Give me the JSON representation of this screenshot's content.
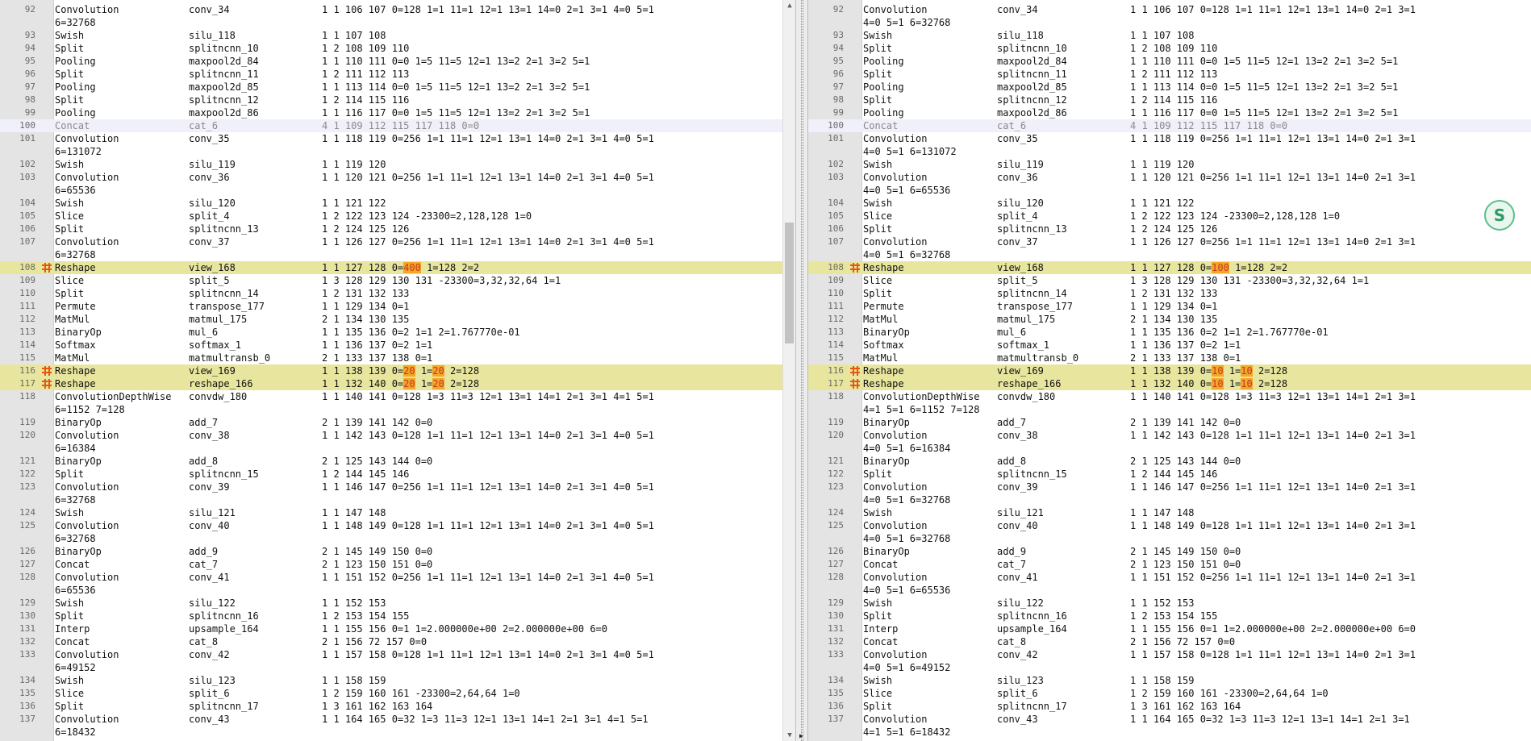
{
  "left": {
    "lines": [
      {
        "n": "92",
        "c": [
          "Convolution",
          "conv_34",
          "1 1 106 107 0=128 1=1 11=1 12=1 13=1 14=0 2=1 3=1 4=0 5=1"
        ]
      },
      {
        "n": "",
        "c": [
          "6=32768",
          "",
          ""
        ],
        "cont": true
      },
      {
        "n": "93",
        "c": [
          "Swish",
          "silu_118",
          "1 1 107 108"
        ]
      },
      {
        "n": "94",
        "c": [
          "Split",
          "splitncnn_10",
          "1 2 108 109 110"
        ]
      },
      {
        "n": "95",
        "c": [
          "Pooling",
          "maxpool2d_84",
          "1 1 110 111 0=0 1=5 11=5 12=1 13=2 2=1 3=2 5=1"
        ]
      },
      {
        "n": "96",
        "c": [
          "Split",
          "splitncnn_11",
          "1 2 111 112 113"
        ]
      },
      {
        "n": "97",
        "c": [
          "Pooling",
          "maxpool2d_85",
          "1 1 113 114 0=0 1=5 11=5 12=1 13=2 2=1 3=2 5=1"
        ]
      },
      {
        "n": "98",
        "c": [
          "Split",
          "splitncnn_12",
          "1 2 114 115 116"
        ]
      },
      {
        "n": "99",
        "c": [
          "Pooling",
          "maxpool2d_86",
          "1 1 116 117 0=0 1=5 11=5 12=1 13=2 2=1 3=2 5=1"
        ]
      },
      {
        "n": "100",
        "c": [
          "Concat",
          "cat_6",
          "4 1 109 112 115 117 118 0=0"
        ],
        "cur": true
      },
      {
        "n": "101",
        "c": [
          "Convolution",
          "conv_35",
          "1 1 118 119 0=256 1=1 11=1 12=1 13=1 14=0 2=1 3=1 4=0 5=1"
        ]
      },
      {
        "n": "",
        "c": [
          "6=131072",
          "",
          ""
        ],
        "cont": true
      },
      {
        "n": "102",
        "c": [
          "Swish",
          "silu_119",
          "1 1 119 120"
        ]
      },
      {
        "n": "103",
        "c": [
          "Convolution",
          "conv_36",
          "1 1 120 121 0=256 1=1 11=1 12=1 13=1 14=0 2=1 3=1 4=0 5=1"
        ]
      },
      {
        "n": "",
        "c": [
          "6=65536",
          "",
          ""
        ],
        "cont": true
      },
      {
        "n": "104",
        "c": [
          "Swish",
          "silu_120",
          "1 1 121 122"
        ]
      },
      {
        "n": "105",
        "c": [
          "Slice",
          "split_4",
          "1 2 122 123 124 -23300=2,128,128 1=0"
        ]
      },
      {
        "n": "106",
        "c": [
          "Split",
          "splitncnn_13",
          "1 2 124 125 126"
        ]
      },
      {
        "n": "107",
        "c": [
          "Convolution",
          "conv_37",
          "1 1 126 127 0=256 1=1 11=1 12=1 13=1 14=0 2=1 3=1 4=0 5=1"
        ]
      },
      {
        "n": "",
        "c": [
          "6=32768",
          "",
          ""
        ],
        "cont": true
      },
      {
        "n": "108",
        "c": [
          "Reshape",
          "view_168",
          "1 1 127 128 0="
        ],
        "diff": [
          "400"
        ],
        "tail": " 1=128 2=2",
        "hl": true
      },
      {
        "n": "109",
        "c": [
          "Slice",
          "split_5",
          "1 3 128 129 130 131 -23300=3,32,32,64 1=1"
        ]
      },
      {
        "n": "110",
        "c": [
          "Split",
          "splitncnn_14",
          "1 2 131 132 133"
        ]
      },
      {
        "n": "111",
        "c": [
          "Permute",
          "transpose_177",
          "1 1 129 134 0=1"
        ]
      },
      {
        "n": "112",
        "c": [
          "MatMul",
          "matmul_175",
          "2 1 134 130 135"
        ]
      },
      {
        "n": "113",
        "c": [
          "BinaryOp",
          "mul_6",
          "1 1 135 136 0=2 1=1 2=1.767770e-01"
        ]
      },
      {
        "n": "114",
        "c": [
          "Softmax",
          "softmax_1",
          "1 1 136 137 0=2 1=1"
        ]
      },
      {
        "n": "115",
        "c": [
          "MatMul",
          "matmultransb_0",
          "2 1 133 137 138 0=1"
        ]
      },
      {
        "n": "116",
        "c": [
          "Reshape",
          "view_169",
          "1 1 138 139 0="
        ],
        "diff": [
          "20",
          " 1=",
          "20"
        ],
        "tail": " 2=128",
        "hl": true
      },
      {
        "n": "117",
        "c": [
          "Reshape",
          "reshape_166",
          "1 1 132 140 0="
        ],
        "diff": [
          "20",
          " 1=",
          "20"
        ],
        "tail": " 2=128",
        "hl": true
      },
      {
        "n": "118",
        "c": [
          "ConvolutionDepthWise",
          "convdw_180",
          "1 1 140 141 0=128 1=3 11=3 12=1 13=1 14=1 2=1 3=1 4=1 5=1"
        ]
      },
      {
        "n": "",
        "c": [
          "6=1152 7=128",
          "",
          ""
        ],
        "cont": true
      },
      {
        "n": "119",
        "c": [
          "BinaryOp",
          "add_7",
          "2 1 139 141 142 0=0"
        ]
      },
      {
        "n": "120",
        "c": [
          "Convolution",
          "conv_38",
          "1 1 142 143 0=128 1=1 11=1 12=1 13=1 14=0 2=1 3=1 4=0 5=1"
        ]
      },
      {
        "n": "",
        "c": [
          "6=16384",
          "",
          ""
        ],
        "cont": true
      },
      {
        "n": "121",
        "c": [
          "BinaryOp",
          "add_8",
          "2 1 125 143 144 0=0"
        ]
      },
      {
        "n": "122",
        "c": [
          "Split",
          "splitncnn_15",
          "1 2 144 145 146"
        ]
      },
      {
        "n": "123",
        "c": [
          "Convolution",
          "conv_39",
          "1 1 146 147 0=256 1=1 11=1 12=1 13=1 14=0 2=1 3=1 4=0 5=1"
        ]
      },
      {
        "n": "",
        "c": [
          "6=32768",
          "",
          ""
        ],
        "cont": true
      },
      {
        "n": "124",
        "c": [
          "Swish",
          "silu_121",
          "1 1 147 148"
        ]
      },
      {
        "n": "125",
        "c": [
          "Convolution",
          "conv_40",
          "1 1 148 149 0=128 1=1 11=1 12=1 13=1 14=0 2=1 3=1 4=0 5=1"
        ]
      },
      {
        "n": "",
        "c": [
          "6=32768",
          "",
          ""
        ],
        "cont": true
      },
      {
        "n": "126",
        "c": [
          "BinaryOp",
          "add_9",
          "2 1 145 149 150 0=0"
        ]
      },
      {
        "n": "127",
        "c": [
          "Concat",
          "cat_7",
          "2 1 123 150 151 0=0"
        ]
      },
      {
        "n": "128",
        "c": [
          "Convolution",
          "conv_41",
          "1 1 151 152 0=256 1=1 11=1 12=1 13=1 14=0 2=1 3=1 4=0 5=1"
        ]
      },
      {
        "n": "",
        "c": [
          "6=65536",
          "",
          ""
        ],
        "cont": true
      },
      {
        "n": "129",
        "c": [
          "Swish",
          "silu_122",
          "1 1 152 153"
        ]
      },
      {
        "n": "130",
        "c": [
          "Split",
          "splitncnn_16",
          "1 2 153 154 155"
        ]
      },
      {
        "n": "131",
        "c": [
          "Interp",
          "upsample_164",
          "1 1 155 156 0=1 1=2.000000e+00 2=2.000000e+00 6=0"
        ]
      },
      {
        "n": "132",
        "c": [
          "Concat",
          "cat_8",
          "2 1 156 72 157 0=0"
        ]
      },
      {
        "n": "133",
        "c": [
          "Convolution",
          "conv_42",
          "1 1 157 158 0=128 1=1 11=1 12=1 13=1 14=0 2=1 3=1 4=0 5=1"
        ]
      },
      {
        "n": "",
        "c": [
          "6=49152",
          "",
          ""
        ],
        "cont": true
      },
      {
        "n": "134",
        "c": [
          "Swish",
          "silu_123",
          "1 1 158 159"
        ]
      },
      {
        "n": "135",
        "c": [
          "Slice",
          "split_6",
          "1 2 159 160 161 -23300=2,64,64 1=0"
        ]
      },
      {
        "n": "136",
        "c": [
          "Split",
          "splitncnn_17",
          "1 3 161 162 163 164"
        ]
      },
      {
        "n": "137",
        "c": [
          "Convolution",
          "conv_43",
          "1 1 164 165 0=32 1=3 11=3 12=1 13=1 14=1 2=1 3=1 4=1 5=1"
        ]
      },
      {
        "n": "",
        "c": [
          "6=18432",
          "",
          ""
        ],
        "cont": true
      }
    ]
  },
  "right": {
    "lines": [
      {
        "n": "92",
        "c": [
          "Convolution",
          "conv_34",
          "1 1 106 107 0=128 1=1 11=1 12=1 13=1 14=0 2=1 3=1"
        ]
      },
      {
        "n": "",
        "c": [
          "4=0 5=1 6=32768",
          "",
          ""
        ],
        "cont": true
      },
      {
        "n": "93",
        "c": [
          "Swish",
          "silu_118",
          "1 1 107 108"
        ]
      },
      {
        "n": "94",
        "c": [
          "Split",
          "splitncnn_10",
          "1 2 108 109 110"
        ]
      },
      {
        "n": "95",
        "c": [
          "Pooling",
          "maxpool2d_84",
          "1 1 110 111 0=0 1=5 11=5 12=1 13=2 2=1 3=2 5=1"
        ]
      },
      {
        "n": "96",
        "c": [
          "Split",
          "splitncnn_11",
          "1 2 111 112 113"
        ]
      },
      {
        "n": "97",
        "c": [
          "Pooling",
          "maxpool2d_85",
          "1 1 113 114 0=0 1=5 11=5 12=1 13=2 2=1 3=2 5=1"
        ]
      },
      {
        "n": "98",
        "c": [
          "Split",
          "splitncnn_12",
          "1 2 114 115 116"
        ]
      },
      {
        "n": "99",
        "c": [
          "Pooling",
          "maxpool2d_86",
          "1 1 116 117 0=0 1=5 11=5 12=1 13=2 2=1 3=2 5=1"
        ]
      },
      {
        "n": "100",
        "c": [
          "Concat",
          "cat_6",
          "4 1 109 112 115 117 118 0=0"
        ],
        "cur": true
      },
      {
        "n": "101",
        "c": [
          "Convolution",
          "conv_35",
          "1 1 118 119 0=256 1=1 11=1 12=1 13=1 14=0 2=1 3=1"
        ]
      },
      {
        "n": "",
        "c": [
          "4=0 5=1 6=131072",
          "",
          ""
        ],
        "cont": true
      },
      {
        "n": "102",
        "c": [
          "Swish",
          "silu_119",
          "1 1 119 120"
        ]
      },
      {
        "n": "103",
        "c": [
          "Convolution",
          "conv_36",
          "1 1 120 121 0=256 1=1 11=1 12=1 13=1 14=0 2=1 3=1"
        ]
      },
      {
        "n": "",
        "c": [
          "4=0 5=1 6=65536",
          "",
          ""
        ],
        "cont": true
      },
      {
        "n": "104",
        "c": [
          "Swish",
          "silu_120",
          "1 1 121 122"
        ]
      },
      {
        "n": "105",
        "c": [
          "Slice",
          "split_4",
          "1 2 122 123 124 -23300=2,128,128 1=0"
        ]
      },
      {
        "n": "106",
        "c": [
          "Split",
          "splitncnn_13",
          "1 2 124 125 126"
        ]
      },
      {
        "n": "107",
        "c": [
          "Convolution",
          "conv_37",
          "1 1 126 127 0=256 1=1 11=1 12=1 13=1 14=0 2=1 3=1"
        ]
      },
      {
        "n": "",
        "c": [
          "4=0 5=1 6=32768",
          "",
          ""
        ],
        "cont": true
      },
      {
        "n": "108",
        "c": [
          "Reshape",
          "view_168",
          "1 1 127 128 0="
        ],
        "diff": [
          "100"
        ],
        "tail": " 1=128 2=2",
        "hl": true
      },
      {
        "n": "109",
        "c": [
          "Slice",
          "split_5",
          "1 3 128 129 130 131 -23300=3,32,32,64 1=1"
        ]
      },
      {
        "n": "110",
        "c": [
          "Split",
          "splitncnn_14",
          "1 2 131 132 133"
        ]
      },
      {
        "n": "111",
        "c": [
          "Permute",
          "transpose_177",
          "1 1 129 134 0=1"
        ]
      },
      {
        "n": "112",
        "c": [
          "MatMul",
          "matmul_175",
          "2 1 134 130 135"
        ]
      },
      {
        "n": "113",
        "c": [
          "BinaryOp",
          "mul_6",
          "1 1 135 136 0=2 1=1 2=1.767770e-01"
        ]
      },
      {
        "n": "114",
        "c": [
          "Softmax",
          "softmax_1",
          "1 1 136 137 0=2 1=1"
        ]
      },
      {
        "n": "115",
        "c": [
          "MatMul",
          "matmultransb_0",
          "2 1 133 137 138 0=1"
        ]
      },
      {
        "n": "116",
        "c": [
          "Reshape",
          "view_169",
          "1 1 138 139 0="
        ],
        "diff": [
          "10",
          " 1=",
          "10"
        ],
        "tail": " 2=128",
        "hl": true
      },
      {
        "n": "117",
        "c": [
          "Reshape",
          "reshape_166",
          "1 1 132 140 0="
        ],
        "diff": [
          "10",
          " 1=",
          "10"
        ],
        "tail": " 2=128",
        "hl": true
      },
      {
        "n": "118",
        "c": [
          "ConvolutionDepthWise",
          "convdw_180",
          "1 1 140 141 0=128 1=3 11=3 12=1 13=1 14=1 2=1 3=1"
        ]
      },
      {
        "n": "",
        "c": [
          "4=1 5=1 6=1152 7=128",
          "",
          ""
        ],
        "cont": true
      },
      {
        "n": "119",
        "c": [
          "BinaryOp",
          "add_7",
          "2 1 139 141 142 0=0"
        ]
      },
      {
        "n": "120",
        "c": [
          "Convolution",
          "conv_38",
          "1 1 142 143 0=128 1=1 11=1 12=1 13=1 14=0 2=1 3=1"
        ]
      },
      {
        "n": "",
        "c": [
          "4=0 5=1 6=16384",
          "",
          ""
        ],
        "cont": true
      },
      {
        "n": "121",
        "c": [
          "BinaryOp",
          "add_8",
          "2 1 125 143 144 0=0"
        ]
      },
      {
        "n": "122",
        "c": [
          "Split",
          "splitncnn_15",
          "1 2 144 145 146"
        ]
      },
      {
        "n": "123",
        "c": [
          "Convolution",
          "conv_39",
          "1 1 146 147 0=256 1=1 11=1 12=1 13=1 14=0 2=1 3=1"
        ]
      },
      {
        "n": "",
        "c": [
          "4=0 5=1 6=32768",
          "",
          ""
        ],
        "cont": true
      },
      {
        "n": "124",
        "c": [
          "Swish",
          "silu_121",
          "1 1 147 148"
        ]
      },
      {
        "n": "125",
        "c": [
          "Convolution",
          "conv_40",
          "1 1 148 149 0=128 1=1 11=1 12=1 13=1 14=0 2=1 3=1"
        ]
      },
      {
        "n": "",
        "c": [
          "4=0 5=1 6=32768",
          "",
          ""
        ],
        "cont": true
      },
      {
        "n": "126",
        "c": [
          "BinaryOp",
          "add_9",
          "2 1 145 149 150 0=0"
        ]
      },
      {
        "n": "127",
        "c": [
          "Concat",
          "cat_7",
          "2 1 123 150 151 0=0"
        ]
      },
      {
        "n": "128",
        "c": [
          "Convolution",
          "conv_41",
          "1 1 151 152 0=256 1=1 11=1 12=1 13=1 14=0 2=1 3=1"
        ]
      },
      {
        "n": "",
        "c": [
          "4=0 5=1 6=65536",
          "",
          ""
        ],
        "cont": true
      },
      {
        "n": "129",
        "c": [
          "Swish",
          "silu_122",
          "1 1 152 153"
        ]
      },
      {
        "n": "130",
        "c": [
          "Split",
          "splitncnn_16",
          "1 2 153 154 155"
        ]
      },
      {
        "n": "131",
        "c": [
          "Interp",
          "upsample_164",
          "1 1 155 156 0=1 1=2.000000e+00 2=2.000000e+00 6=0"
        ]
      },
      {
        "n": "132",
        "c": [
          "Concat",
          "cat_8",
          "2 1 156 72 157 0=0"
        ]
      },
      {
        "n": "133",
        "c": [
          "Convolution",
          "conv_42",
          "1 1 157 158 0=128 1=1 11=1 12=1 13=1 14=0 2=1 3=1"
        ]
      },
      {
        "n": "",
        "c": [
          "4=0 5=1 6=49152",
          "",
          ""
        ],
        "cont": true
      },
      {
        "n": "134",
        "c": [
          "Swish",
          "silu_123",
          "1 1 158 159"
        ]
      },
      {
        "n": "135",
        "c": [
          "Slice",
          "split_6",
          "1 2 159 160 161 -23300=2,64,64 1=0"
        ]
      },
      {
        "n": "136",
        "c": [
          "Split",
          "splitncnn_17",
          "1 3 161 162 163 164"
        ]
      },
      {
        "n": "137",
        "c": [
          "Convolution",
          "conv_43",
          "1 1 164 165 0=32 1=3 11=3 12=1 13=1 14=1 2=1 3=1"
        ]
      },
      {
        "n": "",
        "c": [
          "4=1 5=1 6=18432",
          "",
          ""
        ],
        "cont": true
      }
    ]
  },
  "icons": {
    "diff_marker": "diff-change-icon",
    "sync": "sync-badge-icon",
    "scroll_up": "arrow-up-icon",
    "scroll_down": "arrow-down-icon"
  },
  "colors": {
    "highlight": "#e8e69e",
    "diff_token": "#f5a623",
    "marker": "#e8560f",
    "gutter": "#e4e4e4"
  }
}
